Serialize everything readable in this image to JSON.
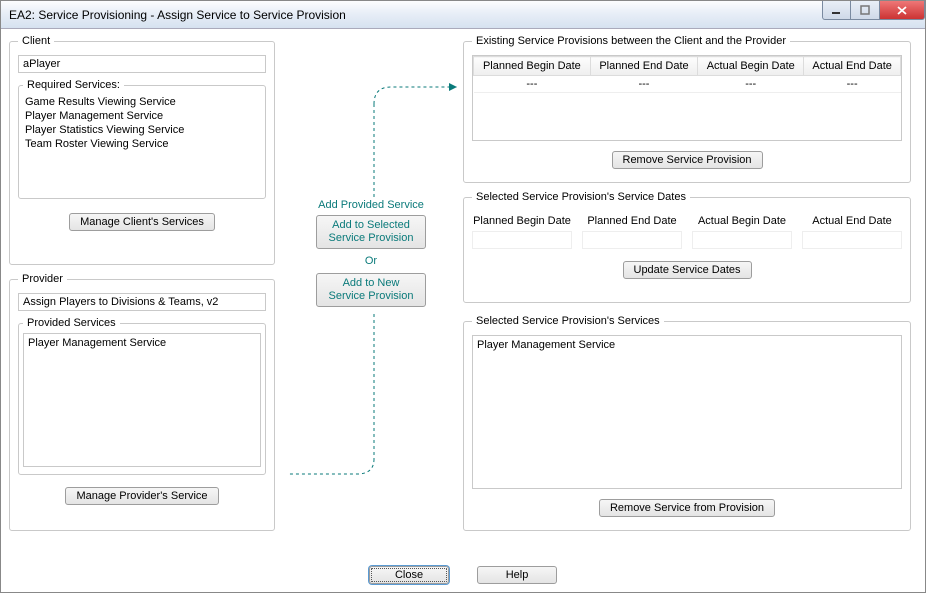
{
  "window": {
    "title": "EA2: Service Provisioning - Assign Service to Service Provision"
  },
  "client": {
    "legend": "Client",
    "name": "aPlayer",
    "required_legend": "Required Services:",
    "required_services": [
      "Game Results Viewing Service",
      "Player Management Service",
      "Player Statistics Viewing Service",
      "Team Roster Viewing Service"
    ],
    "manage_button": "Manage Client's Services"
  },
  "provider": {
    "legend": "Provider",
    "name": "Assign Players to Divisions & Teams, v2",
    "provided_legend": "Provided Services",
    "provided_services": [
      "Player Management Service"
    ],
    "manage_button": "Manage Provider's Service"
  },
  "mid": {
    "heading": "Add Provided Service",
    "add_selected_line1": "Add to Selected",
    "add_selected_line2": "Service Provision",
    "or": "Or",
    "add_new_line1": "Add to New",
    "add_new_line2": "Service Provision"
  },
  "existing": {
    "legend": "Existing Service Provisions between the Client and the Provider",
    "columns": {
      "planned_begin": "Planned Begin Date",
      "planned_end": "Planned End Date",
      "actual_begin": "Actual Begin Date",
      "actual_end": "Actual End Date"
    },
    "rows": [
      {
        "planned_begin": "---",
        "planned_end": "---",
        "actual_begin": "---",
        "actual_end": "---"
      }
    ],
    "remove_button": "Remove Service Provision"
  },
  "dates": {
    "legend": "Selected Service Provision's Service Dates",
    "labels": {
      "planned_begin": "Planned Begin Date",
      "planned_end": "Planned End Date",
      "actual_begin": "Actual Begin Date",
      "actual_end": "Actual End Date"
    },
    "values": {
      "planned_begin": "",
      "planned_end": "",
      "actual_begin": "",
      "actual_end": ""
    },
    "update_button": "Update Service Dates"
  },
  "selected_services": {
    "legend": "Selected Service Provision's Services",
    "items": [
      "Player Management Service"
    ],
    "remove_button": "Remove Service from Provision"
  },
  "footer": {
    "close": "Close",
    "help": "Help"
  }
}
